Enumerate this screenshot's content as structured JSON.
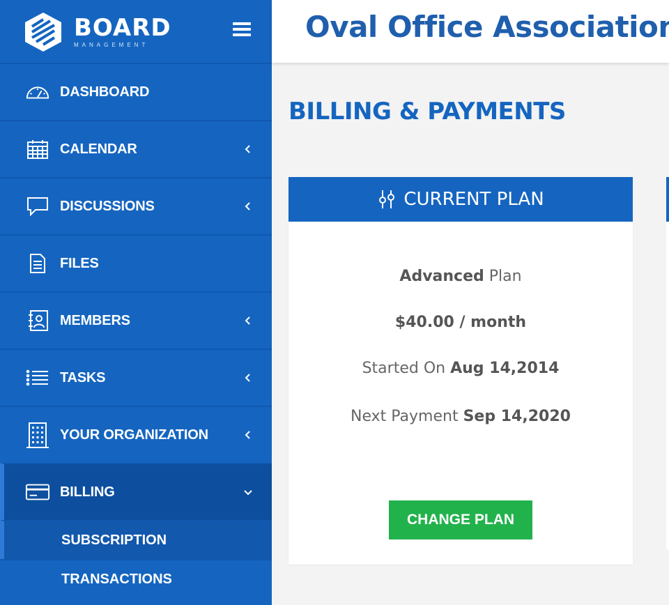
{
  "brand": {
    "name": "BOARD",
    "subtitle": "MANAGEMENT"
  },
  "header": {
    "org_name": "Oval Office Association"
  },
  "sidebar": {
    "items": [
      {
        "label": "DASHBOARD",
        "icon": "dashboard-gauge-icon",
        "has_chevron": false
      },
      {
        "label": "CALENDAR",
        "icon": "calendar-icon",
        "has_chevron": true
      },
      {
        "label": "DISCUSSIONS",
        "icon": "chat-bubble-icon",
        "has_chevron": true
      },
      {
        "label": "FILES",
        "icon": "document-icon",
        "has_chevron": false
      },
      {
        "label": "MEMBERS",
        "icon": "address-book-icon",
        "has_chevron": true
      },
      {
        "label": "TASKS",
        "icon": "list-icon",
        "has_chevron": true
      },
      {
        "label": "YOUR ORGANIZATION",
        "icon": "building-icon",
        "has_chevron": true
      },
      {
        "label": "BILLING",
        "icon": "credit-card-icon",
        "has_chevron": true,
        "expanded": true
      }
    ],
    "subitems": [
      {
        "label": "SUBSCRIPTION"
      },
      {
        "label": "TRANSACTIONS"
      }
    ]
  },
  "page": {
    "title": "BILLING & PAYMENTS"
  },
  "plan_card": {
    "title": "CURRENT PLAN",
    "plan_name": "Advanced",
    "plan_suffix": " Plan",
    "price": "$40.00 / month",
    "started_label": "Started On ",
    "started_date": "Aug 14,2014",
    "next_label": "Next Payment ",
    "next_date": "Sep 14,2020",
    "button_label": "CHANGE PLAN"
  },
  "colors": {
    "sidebar_bg": "#1565c0",
    "active_bg": "#0d4f9e",
    "accent": "#1565c0",
    "button_green": "#22b24c",
    "title_blue": "#1f5fad"
  }
}
